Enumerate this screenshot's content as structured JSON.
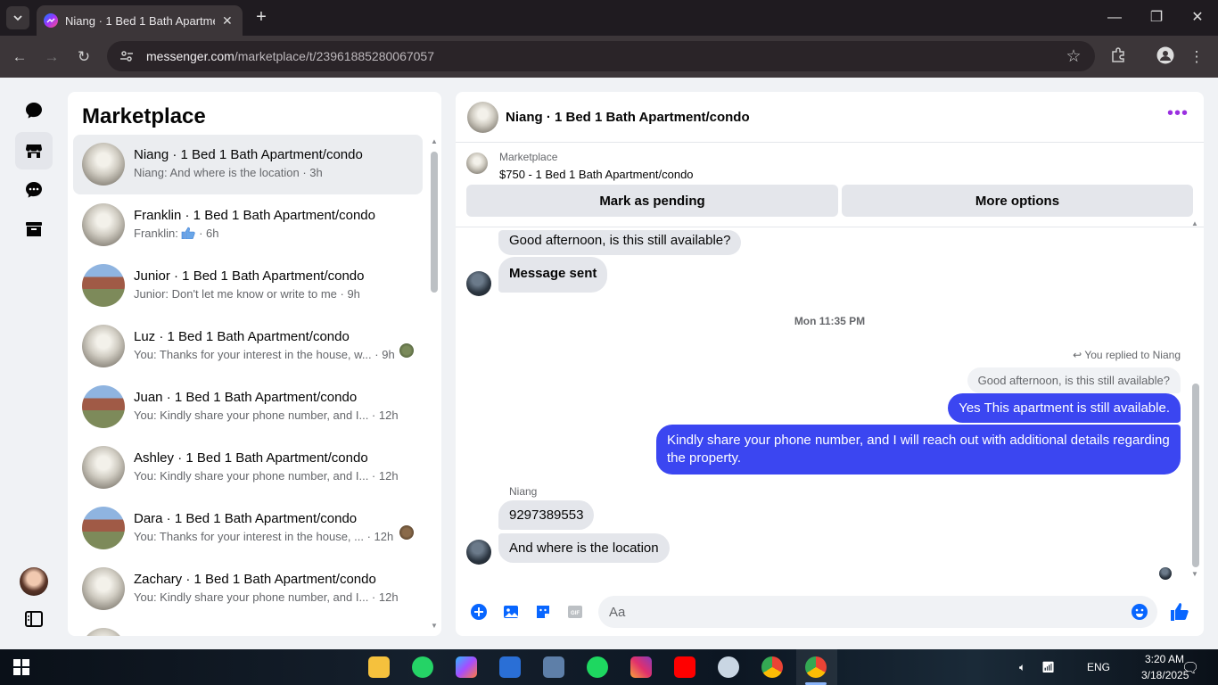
{
  "browser": {
    "tab_title": "Niang · 1 Bed 1 Bath Apartment/condo",
    "url_domain": "messenger.com",
    "url_path": "/marketplace/t/23961885280067057"
  },
  "sidebar": {
    "title": "Marketplace",
    "conversations": [
      {
        "name": "Niang · 1 Bed 1 Bath Apartment/condo",
        "snippet": "Niang: And where is the location · 3h"
      },
      {
        "name": "Franklin · 1 Bed 1 Bath Apartment/condo",
        "snippet_prefix": "Franklin:",
        "snippet_suffix": "· 6h"
      },
      {
        "name": "Junior · 1 Bed 1 Bath Apartment/condo",
        "snippet": "Junior: Don't let me know or write to me · 9h"
      },
      {
        "name": "Luz · 1 Bed 1 Bath Apartment/condo",
        "snippet": "You: Thanks for your interest in the house, w... · 9h"
      },
      {
        "name": "Juan · 1 Bed 1 Bath Apartment/condo",
        "snippet": "You: Kindly share your phone number, and I... · 12h"
      },
      {
        "name": "Ashley · 1 Bed 1 Bath Apartment/condo",
        "snippet": "You: Kindly share your phone number, and I... · 12h"
      },
      {
        "name": "Dara · 1 Bed 1 Bath Apartment/condo",
        "snippet": "You: Thanks for your interest in the house, ... · 12h"
      },
      {
        "name": "Zachary · 1 Bed 1 Bath Apartment/condo",
        "snippet": "You: Kindly share your phone number, and I... · 12h"
      }
    ]
  },
  "chat": {
    "title": "Niang · 1 Bed 1 Bath Apartment/condo",
    "marketplace_label": "Marketplace",
    "listing": "$750 - 1 Bed 1 Bath Apartment/condo",
    "mark_pending": "Mark as pending",
    "more_options": "More options",
    "messages": {
      "m1": "Good afternoon, is this still available?",
      "m2": "Message sent",
      "timestamp": "Mon 11:35 PM",
      "replied_to": "You replied to Niang",
      "quoted": "Good afternoon, is this still available?",
      "out1": "Yes This apartment is still available.",
      "out2": "Kindly share your phone number, and I will reach out with additional details regarding the property.",
      "sender": "Niang",
      "in1": "9297389553",
      "in2": "And where is the location"
    },
    "composer_placeholder": "Aa"
  },
  "taskbar": {
    "time": "3:20 AM",
    "date": "3/18/2025",
    "language": "ENG"
  },
  "colors": {
    "accent": "#3b46f1",
    "messenger_purple": "#9a2fe0",
    "blue_icon": "#0866ff"
  }
}
